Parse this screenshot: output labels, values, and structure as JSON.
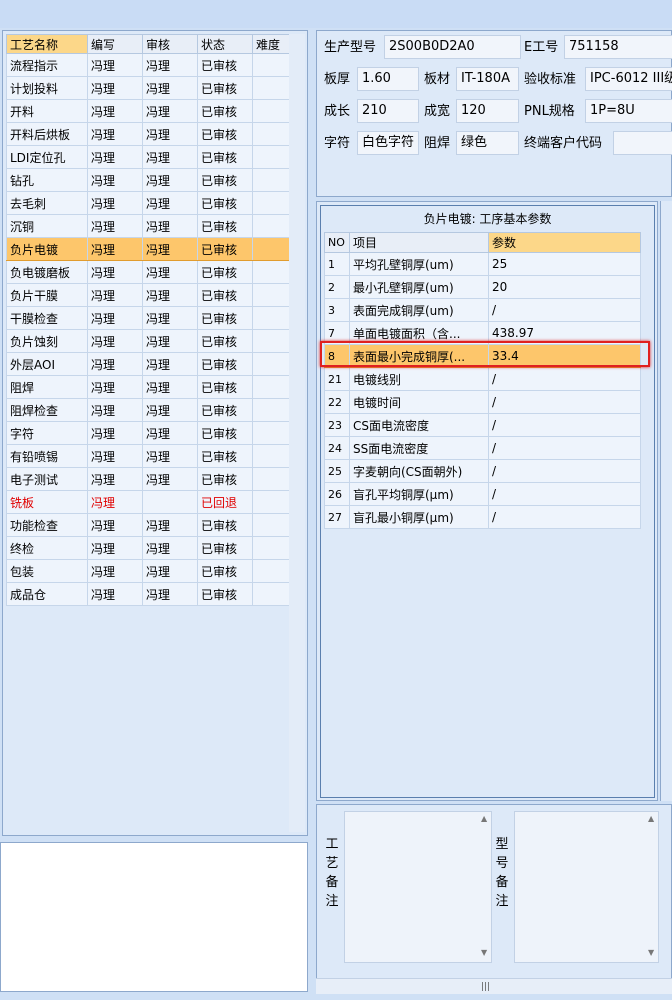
{
  "process_table": {
    "headers": [
      "工艺名称",
      "编写",
      "审核",
      "状态",
      "难度"
    ],
    "rows": [
      {
        "name": "流程指示",
        "writer": "冯理",
        "reviewer": "冯理",
        "status": "已审核",
        "difficulty": ""
      },
      {
        "name": "计划投料",
        "writer": "冯理",
        "reviewer": "冯理",
        "status": "已审核",
        "difficulty": ""
      },
      {
        "name": "开料",
        "writer": "冯理",
        "reviewer": "冯理",
        "status": "已审核",
        "difficulty": ""
      },
      {
        "name": "开料后烘板",
        "writer": "冯理",
        "reviewer": "冯理",
        "status": "已审核",
        "difficulty": ""
      },
      {
        "name": "LDI定位孔",
        "writer": "冯理",
        "reviewer": "冯理",
        "status": "已审核",
        "difficulty": ""
      },
      {
        "name": "钻孔",
        "writer": "冯理",
        "reviewer": "冯理",
        "status": "已审核",
        "difficulty": ""
      },
      {
        "name": "去毛刺",
        "writer": "冯理",
        "reviewer": "冯理",
        "status": "已审核",
        "difficulty": ""
      },
      {
        "name": "沉铜",
        "writer": "冯理",
        "reviewer": "冯理",
        "status": "已审核",
        "difficulty": ""
      },
      {
        "name": "负片电镀",
        "writer": "冯理",
        "reviewer": "冯理",
        "status": "已审核",
        "difficulty": ""
      },
      {
        "name": "负电镀磨板",
        "writer": "冯理",
        "reviewer": "冯理",
        "status": "已审核",
        "difficulty": ""
      },
      {
        "name": "负片干膜",
        "writer": "冯理",
        "reviewer": "冯理",
        "status": "已审核",
        "difficulty": ""
      },
      {
        "name": "干膜检查",
        "writer": "冯理",
        "reviewer": "冯理",
        "status": "已审核",
        "difficulty": ""
      },
      {
        "name": "负片蚀刻",
        "writer": "冯理",
        "reviewer": "冯理",
        "status": "已审核",
        "difficulty": ""
      },
      {
        "name": "外层AOI",
        "writer": "冯理",
        "reviewer": "冯理",
        "status": "已审核",
        "difficulty": ""
      },
      {
        "name": "阻焊",
        "writer": "冯理",
        "reviewer": "冯理",
        "status": "已审核",
        "difficulty": ""
      },
      {
        "name": "阻焊检查",
        "writer": "冯理",
        "reviewer": "冯理",
        "status": "已审核",
        "difficulty": ""
      },
      {
        "name": "字符",
        "writer": "冯理",
        "reviewer": "冯理",
        "status": "已审核",
        "difficulty": ""
      },
      {
        "name": "有铅喷锡",
        "writer": "冯理",
        "reviewer": "冯理",
        "status": "已审核",
        "difficulty": ""
      },
      {
        "name": "电子测试",
        "writer": "冯理",
        "reviewer": "冯理",
        "status": "已审核",
        "difficulty": ""
      },
      {
        "name": "铣板",
        "writer": "冯理",
        "reviewer": "",
        "status": "已回退",
        "difficulty": ""
      },
      {
        "name": "功能检查",
        "writer": "冯理",
        "reviewer": "冯理",
        "status": "已审核",
        "difficulty": ""
      },
      {
        "name": "终检",
        "writer": "冯理",
        "reviewer": "冯理",
        "status": "已审核",
        "difficulty": ""
      },
      {
        "name": "包装",
        "writer": "冯理",
        "reviewer": "冯理",
        "status": "已审核",
        "difficulty": ""
      },
      {
        "name": "成品仓",
        "writer": "冯理",
        "reviewer": "冯理",
        "status": "已审核",
        "difficulty": ""
      }
    ]
  },
  "info": {
    "model_label": "生产型号",
    "model_value": "2S00B0D2A0",
    "eng_label": "E工号",
    "eng_value": "751158",
    "thickness_label": "板厚",
    "thickness_value": "1.60",
    "material_label": "板材",
    "material_value": "IT-180A",
    "standard_label": "验收标准",
    "standard_value": "IPC-6012 III级",
    "length_label": "成长",
    "length_value": "210",
    "width_label": "成宽",
    "width_value": "120",
    "pnl_label": "PNL规格",
    "pnl_value": "1P=8U",
    "char_label": "字符",
    "char_value": "白色字符",
    "mask_label": "阻焊",
    "mask_value": "绿色",
    "customer_label": "终端客户代码",
    "customer_value": ""
  },
  "params": {
    "title": "负片电镀: 工序基本参数",
    "headers": [
      "NO",
      "项目",
      "参数"
    ],
    "rows": [
      {
        "no": "1",
        "item": "平均孔壁铜厚(um)",
        "value": "25"
      },
      {
        "no": "2",
        "item": "最小孔壁铜厚(um)",
        "value": "20"
      },
      {
        "no": "3",
        "item": "表面完成铜厚(um)",
        "value": "/"
      },
      {
        "no": "7",
        "item": "单面电镀面积（含...",
        "value": "438.97"
      },
      {
        "no": "8",
        "item": "表面最小完成铜厚(...",
        "value": "33.4"
      },
      {
        "no": "21",
        "item": "电镀线别",
        "value": "/"
      },
      {
        "no": "22",
        "item": "电镀时间",
        "value": "/"
      },
      {
        "no": "23",
        "item": "CS面电流密度",
        "value": "/"
      },
      {
        "no": "24",
        "item": "SS面电流密度",
        "value": "/"
      },
      {
        "no": "25",
        "item": "字麦朝向(CS面朝外)",
        "value": "/"
      },
      {
        "no": "26",
        "item": "盲孔平均铜厚(μm)",
        "value": "/"
      },
      {
        "no": "27",
        "item": "盲孔最小铜厚(μm)",
        "value": "/"
      }
    ]
  },
  "remarks": {
    "process_label": "工艺备注",
    "model_label": "型号备注"
  },
  "colors": {
    "selection": "#fdc66b",
    "header_highlight": "#fcd789",
    "reverted_text": "#e00000",
    "highlight_box": "#e02020"
  }
}
